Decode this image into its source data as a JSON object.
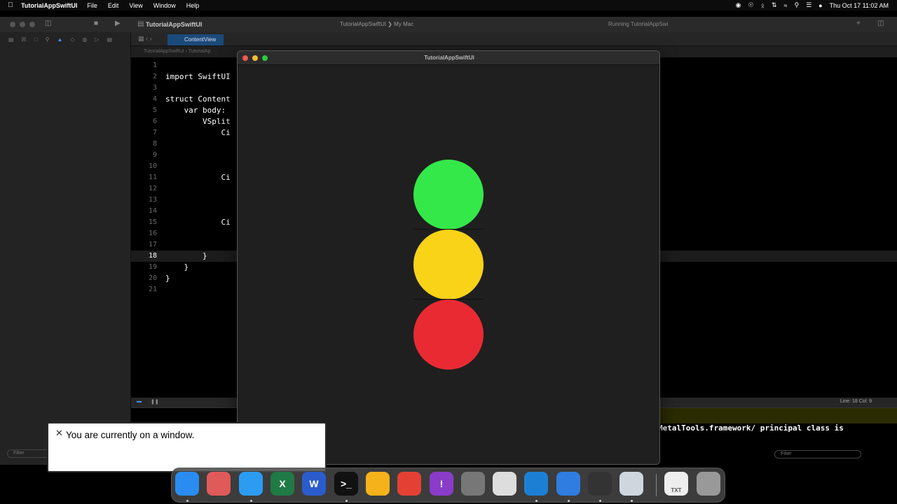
{
  "menubar": {
    "app_name": "TutorialAppSwiftUI",
    "items": [
      "File",
      "Edit",
      "View",
      "Window",
      "Help"
    ],
    "clock": "Thu Oct 17  11:02 AM"
  },
  "xcode": {
    "project_title": "TutorialAppSwiftUI",
    "scheme": "TutorialAppSwiftUI  ❯  My Mac",
    "run_status": "Running TutorialAppSwi",
    "tab_label": "ContentView",
    "jumpbar": "TutorialAppSwiftUI  ›  TutorialAp",
    "nav_filter_placeholder": "Filter",
    "console_filter_placeholder": "Filter",
    "line_col": "Line: 18  Col: 9",
    "console_output": "MetalTools.framework/ principal class is"
  },
  "code_lines": [
    {
      "n": "1",
      "t": ""
    },
    {
      "n": "2",
      "t": "import SwiftUI"
    },
    {
      "n": "3",
      "t": ""
    },
    {
      "n": "4",
      "t": "struct Content"
    },
    {
      "n": "5",
      "t": "    var body:"
    },
    {
      "n": "6",
      "t": "        VSplit"
    },
    {
      "n": "7",
      "t": "            Ci"
    },
    {
      "n": "8",
      "t": ""
    },
    {
      "n": "9",
      "t": ""
    },
    {
      "n": "10",
      "t": ""
    },
    {
      "n": "11",
      "t": "            Ci"
    },
    {
      "n": "12",
      "t": ""
    },
    {
      "n": "13",
      "t": ""
    },
    {
      "n": "14",
      "t": ""
    },
    {
      "n": "15",
      "t": "            Ci"
    },
    {
      "n": "16",
      "t": ""
    },
    {
      "n": "17",
      "t": ""
    },
    {
      "n": "18",
      "t": "        }"
    },
    {
      "n": "19",
      "t": "    }"
    },
    {
      "n": "20",
      "t": "}"
    },
    {
      "n": "21",
      "t": ""
    }
  ],
  "app_window": {
    "title": "TutorialAppSwiftUI",
    "circles": [
      {
        "name": "green-circle",
        "color": "#34e84a"
      },
      {
        "name": "yellow-circle",
        "color": "#f8d317"
      },
      {
        "name": "red-circle",
        "color": "#ea2a33"
      }
    ]
  },
  "caption": {
    "text": "You are currently on a window."
  },
  "dock": {
    "apps": [
      {
        "name": "finder-icon",
        "color": "#2a8cf0"
      },
      {
        "name": "launchpad-icon",
        "color": "#e05a5a"
      },
      {
        "name": "safari-icon",
        "color": "#2b9cf2"
      },
      {
        "name": "excel-icon",
        "color": "#1f7a45",
        "glyph": "X"
      },
      {
        "name": "word-icon",
        "color": "#2b5ccc",
        "glyph": "W"
      },
      {
        "name": "terminal-icon",
        "color": "#111111",
        "glyph": ">_"
      },
      {
        "name": "chrome-canary-icon",
        "color": "#f5b21a"
      },
      {
        "name": "chrome-icon",
        "color": "#e44134"
      },
      {
        "name": "feedback-icon",
        "color": "#8a3cc8",
        "glyph": "!"
      },
      {
        "name": "simulator-icon",
        "color": "#777777"
      },
      {
        "name": "textedit-icon",
        "color": "#dddddd"
      },
      {
        "name": "vscode-icon",
        "color": "#1d7fd3"
      },
      {
        "name": "xcode-icon",
        "color": "#2f7de0"
      },
      {
        "name": "quicktime-icon",
        "color": "#333333"
      },
      {
        "name": "preview-icon",
        "color": "#cfd6dd"
      },
      {
        "name": "txt-file-icon",
        "color": "#eeeeee",
        "glyph": "TXT"
      },
      {
        "name": "trash-icon",
        "color": "#999999"
      }
    ]
  }
}
